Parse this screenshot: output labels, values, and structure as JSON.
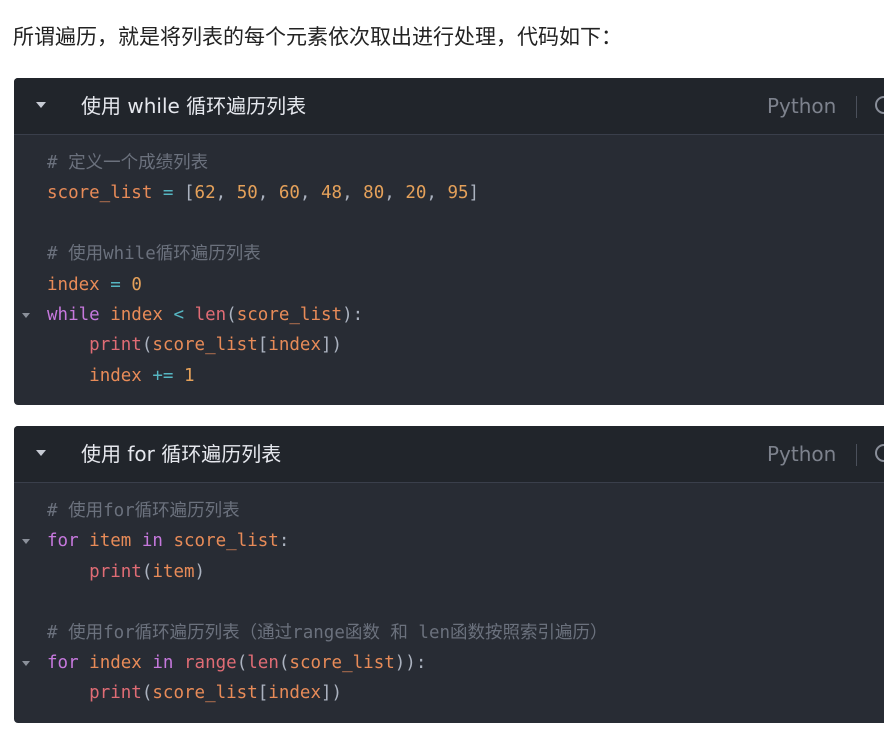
{
  "intro_text": "所谓遍历，就是将列表的每个元素依次取出进行处理，代码如下：",
  "colors": {
    "comment": "#6b717d",
    "variable": "#e88b58",
    "operator": "#56b6c2",
    "number": "#e5a15a",
    "punct": "#abb2bf",
    "keyword": "#c678dd",
    "function": "#e06c75"
  },
  "code_blocks": [
    {
      "title": "使用 while 循环遍历列表",
      "language": "Python",
      "lines": [
        {
          "fold": false,
          "tokens": [
            {
              "t": "comment",
              "v": "# 定义一个成绩列表"
            }
          ]
        },
        {
          "fold": false,
          "tokens": [
            {
              "t": "variable",
              "v": "score_list"
            },
            {
              "t": "punct",
              "v": " "
            },
            {
              "t": "operator",
              "v": "="
            },
            {
              "t": "punct",
              "v": " ["
            },
            {
              "t": "number",
              "v": "62"
            },
            {
              "t": "punct",
              "v": ", "
            },
            {
              "t": "number",
              "v": "50"
            },
            {
              "t": "punct",
              "v": ", "
            },
            {
              "t": "number",
              "v": "60"
            },
            {
              "t": "punct",
              "v": ", "
            },
            {
              "t": "number",
              "v": "48"
            },
            {
              "t": "punct",
              "v": ", "
            },
            {
              "t": "number",
              "v": "80"
            },
            {
              "t": "punct",
              "v": ", "
            },
            {
              "t": "number",
              "v": "20"
            },
            {
              "t": "punct",
              "v": ", "
            },
            {
              "t": "number",
              "v": "95"
            },
            {
              "t": "punct",
              "v": "]"
            }
          ]
        },
        {
          "fold": false,
          "tokens": []
        },
        {
          "fold": false,
          "tokens": [
            {
              "t": "comment",
              "v": "# 使用while循环遍历列表"
            }
          ]
        },
        {
          "fold": false,
          "tokens": [
            {
              "t": "variable",
              "v": "index"
            },
            {
              "t": "punct",
              "v": " "
            },
            {
              "t": "operator",
              "v": "="
            },
            {
              "t": "punct",
              "v": " "
            },
            {
              "t": "number",
              "v": "0"
            }
          ]
        },
        {
          "fold": true,
          "tokens": [
            {
              "t": "keyword",
              "v": "while"
            },
            {
              "t": "punct",
              "v": " "
            },
            {
              "t": "variable",
              "v": "index"
            },
            {
              "t": "punct",
              "v": " "
            },
            {
              "t": "operator",
              "v": "<"
            },
            {
              "t": "punct",
              "v": " "
            },
            {
              "t": "function",
              "v": "len"
            },
            {
              "t": "punct",
              "v": "("
            },
            {
              "t": "variable",
              "v": "score_list"
            },
            {
              "t": "punct",
              "v": "):"
            }
          ]
        },
        {
          "fold": false,
          "tokens": [
            {
              "t": "punct",
              "v": "    "
            },
            {
              "t": "function",
              "v": "print"
            },
            {
              "t": "punct",
              "v": "("
            },
            {
              "t": "variable",
              "v": "score_list"
            },
            {
              "t": "punct",
              "v": "["
            },
            {
              "t": "variable",
              "v": "index"
            },
            {
              "t": "punct",
              "v": "])"
            }
          ]
        },
        {
          "fold": false,
          "tokens": [
            {
              "t": "punct",
              "v": "    "
            },
            {
              "t": "variable",
              "v": "index"
            },
            {
              "t": "punct",
              "v": " "
            },
            {
              "t": "operator",
              "v": "+="
            },
            {
              "t": "punct",
              "v": " "
            },
            {
              "t": "number",
              "v": "1"
            }
          ]
        }
      ]
    },
    {
      "title": "使用 for 循环遍历列表",
      "language": "Python",
      "lines": [
        {
          "fold": false,
          "tokens": [
            {
              "t": "comment",
              "v": "# 使用for循环遍历列表"
            }
          ]
        },
        {
          "fold": true,
          "tokens": [
            {
              "t": "keyword",
              "v": "for"
            },
            {
              "t": "punct",
              "v": " "
            },
            {
              "t": "variable",
              "v": "item"
            },
            {
              "t": "punct",
              "v": " "
            },
            {
              "t": "keyword",
              "v": "in"
            },
            {
              "t": "punct",
              "v": " "
            },
            {
              "t": "variable",
              "v": "score_list"
            },
            {
              "t": "punct",
              "v": ":"
            }
          ]
        },
        {
          "fold": false,
          "tokens": [
            {
              "t": "punct",
              "v": "    "
            },
            {
              "t": "function",
              "v": "print"
            },
            {
              "t": "punct",
              "v": "("
            },
            {
              "t": "variable",
              "v": "item"
            },
            {
              "t": "punct",
              "v": ")"
            }
          ]
        },
        {
          "fold": false,
          "tokens": []
        },
        {
          "fold": false,
          "tokens": [
            {
              "t": "comment",
              "v": "# 使用for循环遍历列表（通过range函数 和 len函数按照索引遍历）"
            }
          ]
        },
        {
          "fold": true,
          "tokens": [
            {
              "t": "keyword",
              "v": "for"
            },
            {
              "t": "punct",
              "v": " "
            },
            {
              "t": "variable",
              "v": "index"
            },
            {
              "t": "punct",
              "v": " "
            },
            {
              "t": "keyword",
              "v": "in"
            },
            {
              "t": "punct",
              "v": " "
            },
            {
              "t": "function",
              "v": "range"
            },
            {
              "t": "punct",
              "v": "("
            },
            {
              "t": "function",
              "v": "len"
            },
            {
              "t": "punct",
              "v": "("
            },
            {
              "t": "variable",
              "v": "score_list"
            },
            {
              "t": "punct",
              "v": ")):"
            }
          ]
        },
        {
          "fold": false,
          "tokens": [
            {
              "t": "punct",
              "v": "    "
            },
            {
              "t": "function",
              "v": "print"
            },
            {
              "t": "punct",
              "v": "("
            },
            {
              "t": "variable",
              "v": "score_list"
            },
            {
              "t": "punct",
              "v": "["
            },
            {
              "t": "variable",
              "v": "index"
            },
            {
              "t": "punct",
              "v": "])"
            }
          ]
        }
      ]
    }
  ]
}
